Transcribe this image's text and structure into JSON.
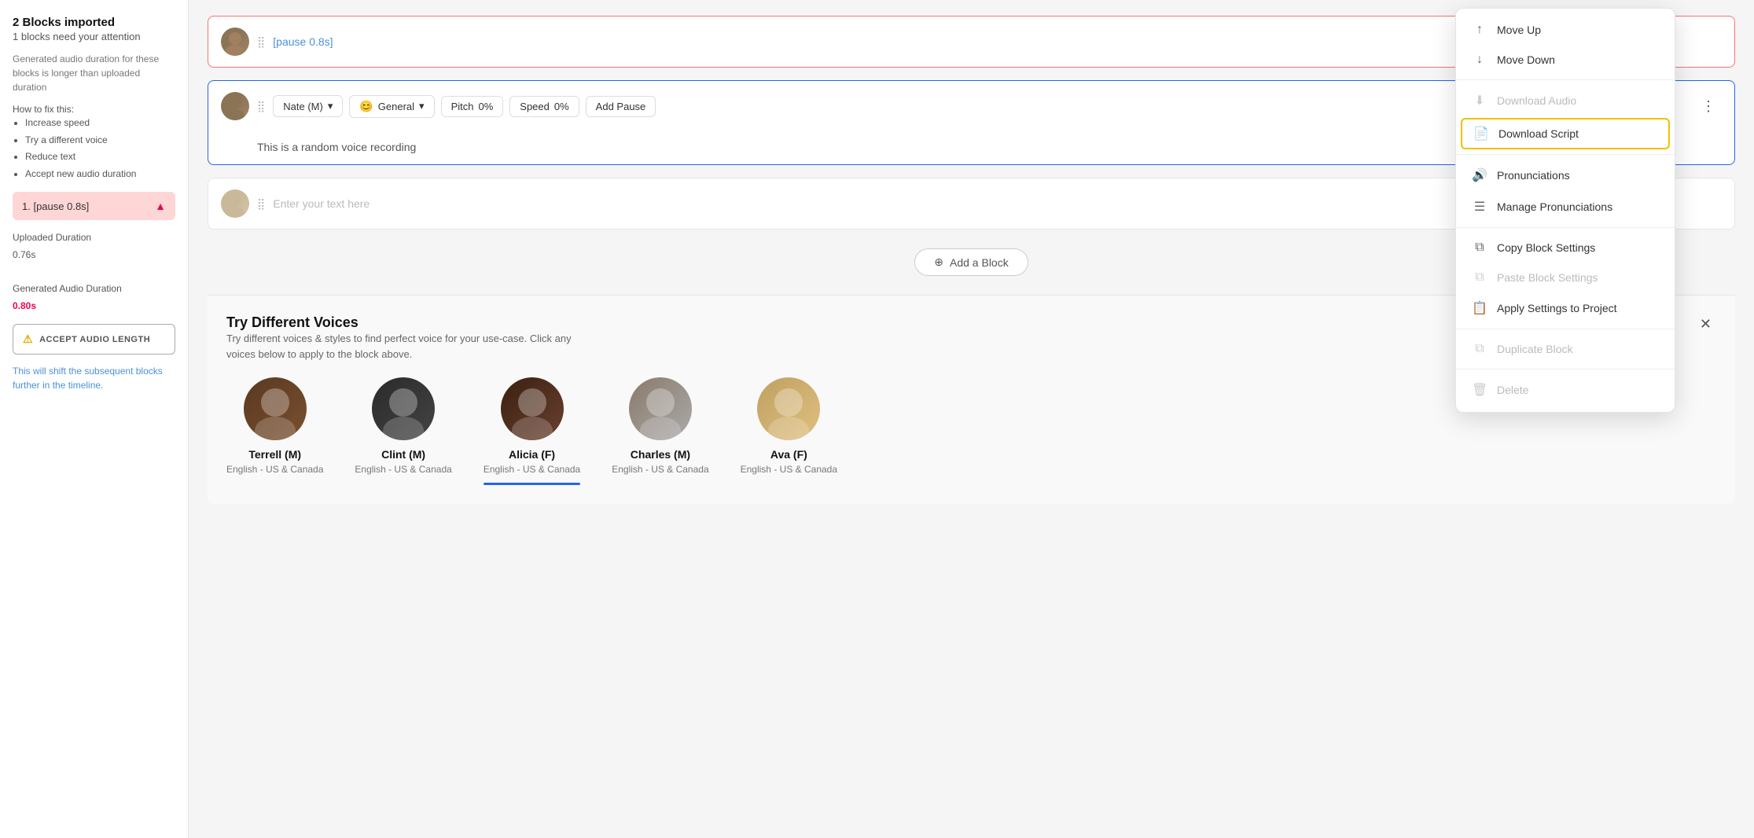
{
  "sidebar": {
    "title": "2 Blocks imported",
    "subtitle": "1 blocks need your attention",
    "description": "Generated audio duration for these blocks is longer than uploaded duration",
    "how_to_fix": "How to fix this:",
    "fixes": [
      "Increase speed",
      "Try a different voice",
      "Reduce text",
      "Accept new audio duration"
    ],
    "block_item_label": "1. [pause 0.8s]",
    "uploaded_duration_label": "Uploaded Duration",
    "uploaded_duration_value": "0.76s",
    "gen_audio_label": "Generated Audio Duration",
    "gen_audio_value": "0.80s",
    "accept_btn_label": "ACCEPT AUDIO LENGTH",
    "shift_note": "This will shift the subsequent blocks further in the timeline."
  },
  "blocks": [
    {
      "id": "block1",
      "type": "pause",
      "text": "[pause 0.8s]",
      "is_error": true
    },
    {
      "id": "block2",
      "type": "voice",
      "voice": "Nate (M)",
      "style": "General",
      "pitch_label": "Pitch",
      "pitch_value": "0%",
      "speed_label": "Speed",
      "speed_value": "0%",
      "add_pause_label": "Add Pause",
      "text": "This is a random voice recording",
      "is_selected": true
    },
    {
      "id": "block3",
      "type": "input",
      "placeholder": "Enter your text here"
    }
  ],
  "add_block_label": "Add a Block",
  "context_menu": {
    "items": [
      {
        "id": "move-up",
        "label": "Move Up",
        "icon": "↑",
        "disabled": false
      },
      {
        "id": "move-down",
        "label": "Move Down",
        "icon": "↓",
        "disabled": false
      },
      {
        "id": "divider1"
      },
      {
        "id": "download-audio",
        "label": "Download Audio",
        "icon": "⬇",
        "disabled": true
      },
      {
        "id": "download-script",
        "label": "Download Script",
        "icon": "📄",
        "highlighted": true,
        "disabled": false
      },
      {
        "id": "divider2"
      },
      {
        "id": "pronunciations",
        "label": "Pronunciations",
        "icon": "🔊",
        "disabled": false
      },
      {
        "id": "manage-pronunciations",
        "label": "Manage Pronunciations",
        "icon": "☰",
        "disabled": false
      },
      {
        "id": "divider3"
      },
      {
        "id": "copy-settings",
        "label": "Copy Block Settings",
        "icon": "⧉",
        "disabled": false
      },
      {
        "id": "paste-settings",
        "label": "Paste Block Settings",
        "icon": "⧉",
        "disabled": true
      },
      {
        "id": "apply-settings",
        "label": "Apply Settings to Project",
        "icon": "📋",
        "disabled": false
      },
      {
        "id": "divider4"
      },
      {
        "id": "duplicate",
        "label": "Duplicate Block",
        "icon": "⧉",
        "disabled": true
      },
      {
        "id": "divider5"
      },
      {
        "id": "delete",
        "label": "Delete",
        "icon": "🗑",
        "disabled": true
      }
    ]
  },
  "voices_panel": {
    "title": "Try Different Voices",
    "description": "Try different voices & styles to find perfect voice for your use-case. Click any voices below to apply to the block above.",
    "voices": [
      {
        "name": "Terrell (M)",
        "region": "English - US & Canada",
        "emoji": "👨🏾"
      },
      {
        "name": "Clint (M)",
        "region": "English - US & Canada",
        "emoji": "👨"
      },
      {
        "name": "Alicia (F)",
        "region": "English - US & Canada",
        "emoji": "👩🏽"
      },
      {
        "name": "Charles (M)",
        "region": "English - US & Canada",
        "emoji": "👨🏻"
      },
      {
        "name": "Ava (F)",
        "region": "English - US & Canada",
        "emoji": "👩🏼"
      }
    ]
  }
}
